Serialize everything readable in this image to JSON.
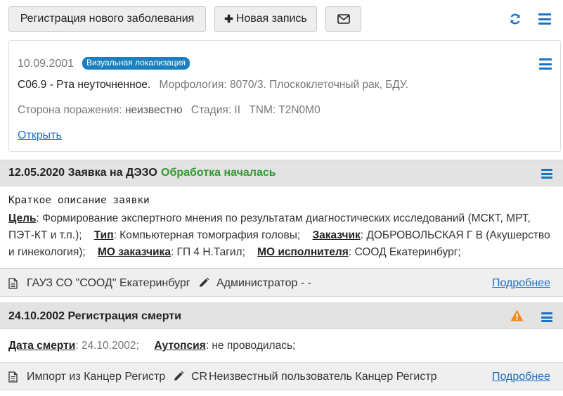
{
  "toolbar": {
    "register_label": "Регистрация нового заболевания",
    "new_record_label": "Новая запись",
    "plus_glyph": "✚",
    "icons": [
      "envelope-icon",
      "refresh-icon",
      "menu-icon"
    ]
  },
  "diagnosis": {
    "date": "10.09.2001",
    "badge": "Визуальная локализация",
    "code_desc": "C06.9 - Рта неуточненное.",
    "morph_label": "Морфология:",
    "morph_code": "8070/3.",
    "morph_desc": "Плоскоклеточный рак, БДУ.",
    "side_label": "Сторона поражения:",
    "side_value": "неизвестно",
    "stage_label": "Стадия:",
    "stage_value": "II",
    "tnm_label": "TNM:",
    "tnm_value": "T2N0M0",
    "open_link": "Открыть"
  },
  "request": {
    "title": "12.05.2020 Заявка на ДЭЗО",
    "status": "Обработка началась",
    "summary_heading": "Краткое описание заявки",
    "goal_label": "Цель",
    "goal_value": ": Формирование экспертного мнения по результатам диагностических исследований (МСКТ, МРТ, ПЭТ-КТ и т.п.);",
    "type_label": "Тип",
    "type_value": ": Компьютерная томография головы;",
    "customer_label": "Заказчик",
    "customer_value": ": ДОБРОВОЛЬСКАЯ Г В (Акушерство и гинекология);",
    "mo_customer_label": "МО заказчика",
    "mo_customer_value": ": ГП 4 Н.Тагил;",
    "mo_executor_label": "МО исполнителя",
    "mo_executor_value": ": СООД Екатеринбург;",
    "org": "ГАУЗ СО \"СООД\" Екатеринбург",
    "author": "Администратор - -",
    "details_link": "Подробнее"
  },
  "death": {
    "title": "24.10.2002 Регистрация смерти",
    "date_label": "Дата смерти",
    "date_value": ": 24.10.2002;",
    "autopsy_label": "Аутопсия",
    "autopsy_value": ": не проводилась;",
    "source": "Импорт из Канцер Регистр",
    "author_prefix": "CR",
    "author": "Неизвестный пользователь Канцер Регистр",
    "details_link": "Подробнее"
  },
  "colors": {
    "accent": "#1a73c5",
    "status_green": "#2e9a2e",
    "warning": "#f08a1c",
    "badge_bg": "#1a7fc1"
  }
}
